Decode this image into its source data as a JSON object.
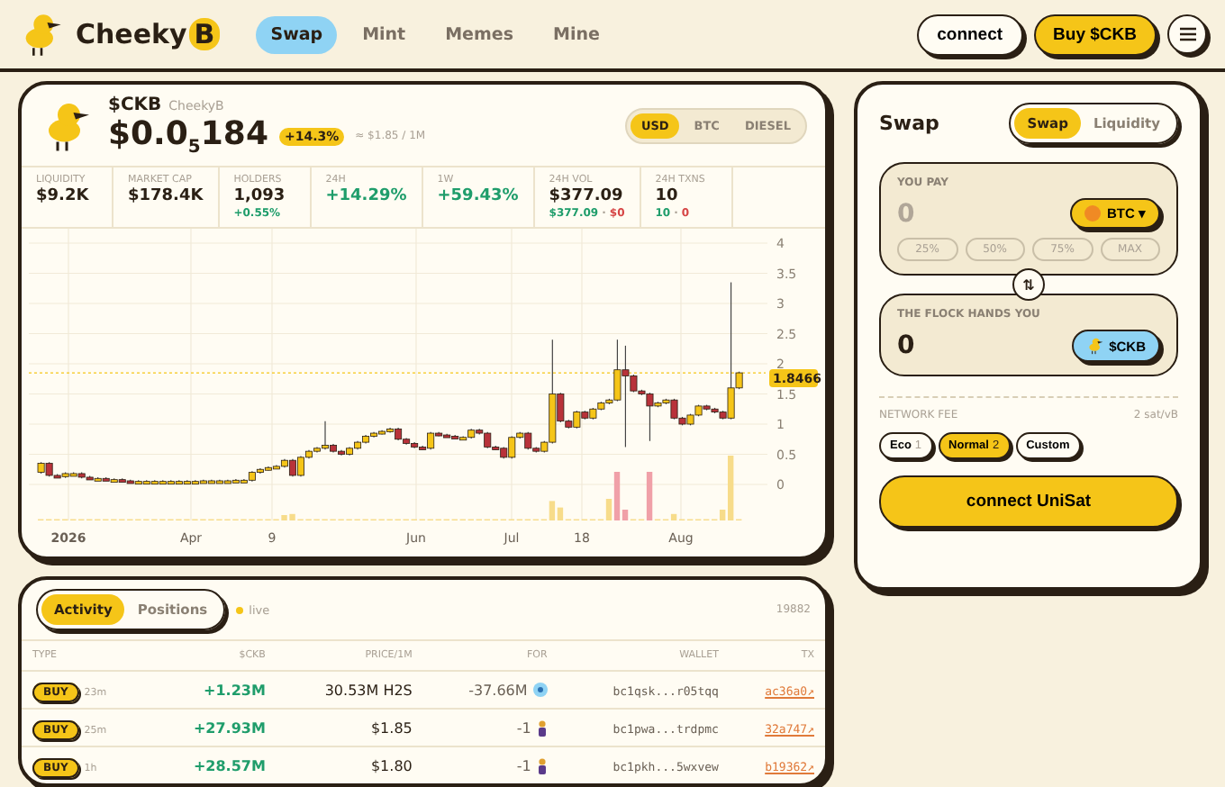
{
  "header": {
    "brand": "Cheeky",
    "brand_badge": "B",
    "nav": [
      {
        "label": "Swap",
        "selected": true
      },
      {
        "label": "Mint",
        "selected": false
      },
      {
        "label": "Memes",
        "selected": false
      },
      {
        "label": "Mine",
        "selected": false
      }
    ],
    "connect": "connect",
    "buy": "Buy $CKB"
  },
  "token": {
    "symbol": "$CKB",
    "name": "CheekyB",
    "price_main": "$0.0",
    "price_sub": "5",
    "price_rest": "184",
    "change": "+14.3%",
    "approx": "≈ $1.85 / 1M",
    "currencies": [
      {
        "label": "USD",
        "selected": true
      },
      {
        "label": "BTC",
        "selected": false
      },
      {
        "label": "DIESEL",
        "selected": false
      }
    ]
  },
  "stats": [
    {
      "label": "LIQUIDITY",
      "value": "$9.2K",
      "positive": false
    },
    {
      "label": "MARKET CAP",
      "value": "$178.4K",
      "positive": false
    },
    {
      "label": "HOLDERS",
      "value": "1,093",
      "positive": false,
      "sub": [
        {
          "text": "+0.55%",
          "color": "#1f9d6b"
        }
      ]
    },
    {
      "label": "24H",
      "value": "+14.29%",
      "positive": true
    },
    {
      "label": "1W",
      "value": "+59.43%",
      "positive": true
    },
    {
      "label": "24H VOL",
      "value": "$377.09",
      "positive": false,
      "sub": [
        {
          "text": "$377.09",
          "color": "#1f9d6b"
        },
        {
          "text": "·"
        },
        {
          "text": "$0",
          "color": "#d64545"
        }
      ]
    },
    {
      "label": "24H TXNS",
      "value": "10",
      "positive": false,
      "sub": [
        {
          "text": "10",
          "color": "#1f9d6b"
        },
        {
          "text": "·"
        },
        {
          "text": "0",
          "color": "#d64545"
        }
      ]
    }
  ],
  "chart": {
    "y_labels": [
      "4",
      "3.5",
      "3",
      "2.5",
      "2",
      "1.5",
      "1",
      "0.5",
      "0"
    ],
    "x_labels": [
      "2026",
      "Apr",
      "9",
      "Jun",
      "Jul",
      "18",
      "Aug"
    ],
    "price_tag": "1.8466"
  },
  "activity": {
    "tabs": [
      {
        "label": "Activity",
        "selected": true
      },
      {
        "label": "Positions",
        "selected": false
      }
    ],
    "live": "live",
    "count": "19882",
    "columns": [
      "TYPE",
      "$CKB",
      "PRICE/1M",
      "FOR",
      "WALLET",
      "TX"
    ],
    "rows": [
      {
        "type": "BUY",
        "age": "23m",
        "amount": "+1.23M",
        "price": "30.53M H2S",
        "for": "-37.66M",
        "for_icon": {
          "kind": "coin"
        },
        "wallet": "bc1qsk...r05tqq",
        "tx": "ac36a0↗"
      },
      {
        "type": "BUY",
        "age": "25m",
        "amount": "+27.93M",
        "price": "$1.85",
        "for": "-1",
        "for_icon": {
          "kind": "figure"
        },
        "wallet": "bc1pwa...trdpmc",
        "tx": "32a747↗"
      },
      {
        "type": "BUY",
        "age": "1h",
        "amount": "+28.57M",
        "price": "$1.80",
        "for": "-1",
        "for_icon": {
          "kind": "figure"
        },
        "wallet": "bc1pkh...5wxvew",
        "tx": "b19362↗"
      }
    ]
  },
  "swap": {
    "title": "Swap",
    "modes": [
      {
        "label": "Swap",
        "selected": true
      },
      {
        "label": "Liquidity",
        "selected": false
      }
    ],
    "pay": {
      "label": "YOU PAY",
      "placeholder": "0",
      "token": "BTC",
      "caret": "▾",
      "presets": [
        "25%",
        "50%",
        "75%",
        "MAX"
      ]
    },
    "flip": "⇅",
    "receive": {
      "label": "THE FLOCK HANDS YOU",
      "value": "0",
      "token": "$CKB"
    },
    "fee": {
      "label": "NETWORK FEE",
      "rate": "2 sat/vB",
      "options": [
        {
          "label": "Eco",
          "level_text": "1",
          "selected": false
        },
        {
          "label": "Normal",
          "level_text": "2",
          "selected": true
        },
        {
          "label": "Custom",
          "selected": false
        }
      ]
    },
    "action": "connect UniSat"
  }
}
